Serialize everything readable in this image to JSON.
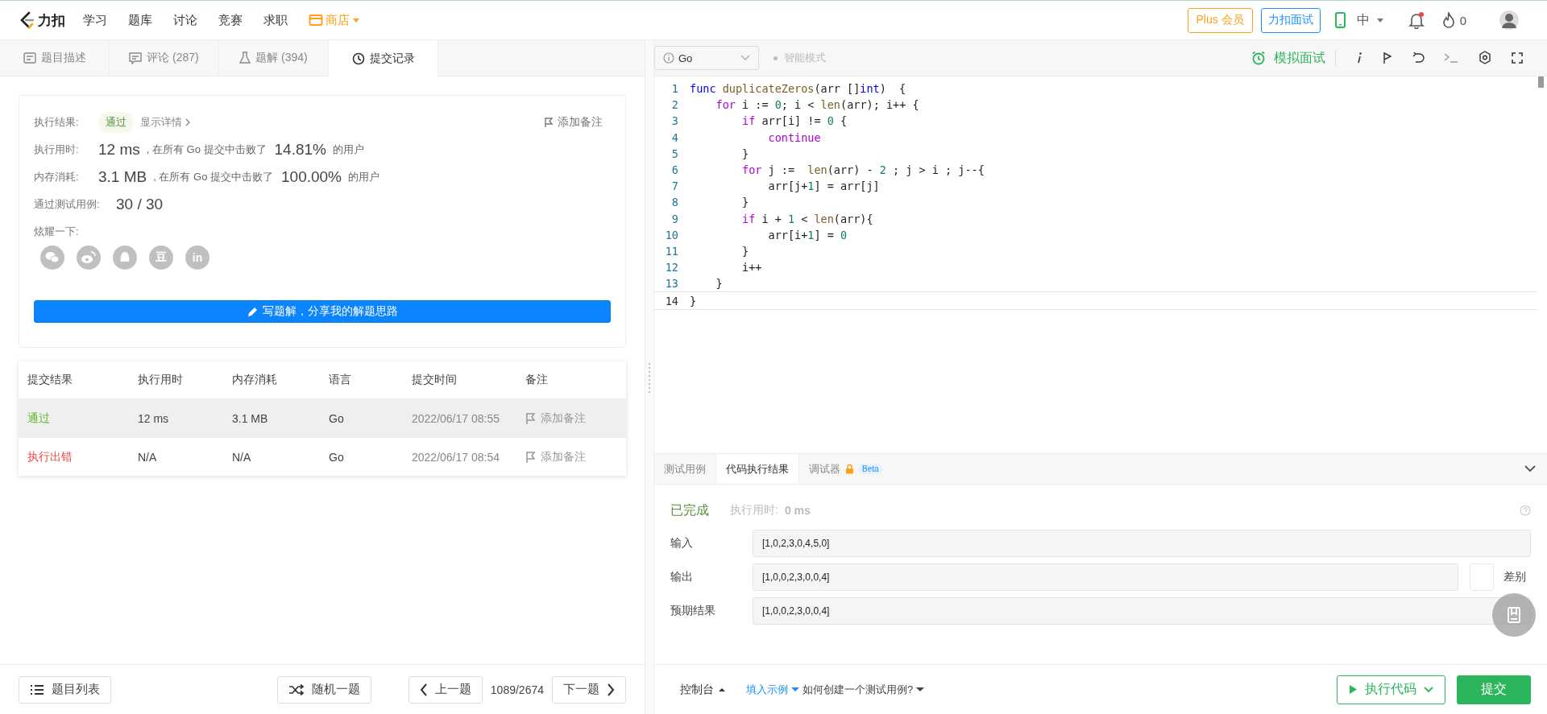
{
  "header": {
    "logo_text": "力扣",
    "nav": [
      {
        "label": "学习",
        "kind": "plain"
      },
      {
        "label": "题库",
        "kind": "plain"
      },
      {
        "label": "讨论",
        "kind": "plain"
      },
      {
        "label": "竞赛",
        "kind": "plain"
      },
      {
        "label": "求职",
        "kind": "plain"
      },
      {
        "label": "商店",
        "kind": "shop"
      }
    ],
    "plus_button": "Plus 会员",
    "interview_button": "力扣面试",
    "language": "中",
    "has_unread": true,
    "streak": "0"
  },
  "left_tabs": [
    {
      "label": "题目描述",
      "kind": "description",
      "selected": false
    },
    {
      "label": "评论 (287)",
      "kind": "comments",
      "selected": false
    },
    {
      "label": "题解 (394)",
      "kind": "solutions",
      "selected": false
    },
    {
      "label": "提交记录",
      "kind": "submissions",
      "selected": true
    }
  ],
  "result_card": {
    "result_label": "执行结果:",
    "status": "通过",
    "details_link": "显示详情",
    "add_note": "添加备注",
    "stats": [
      {
        "label": "执行用时:",
        "value": "12 ms",
        "middle": ", 在所有 Go 提交中击败了",
        "percent": "14.81%",
        "tail": "的用户"
      },
      {
        "label": "内存消耗:",
        "value": "3.1 MB",
        "middle": ", 在所有 Go 提交中击败了",
        "percent": "100.00%",
        "tail": "的用户"
      }
    ],
    "tests_label": "通过测试用例:",
    "tests_value": "30 / 30",
    "share_label": "炫耀一下:",
    "share": [
      {
        "kind": "wechat"
      },
      {
        "kind": "weibo"
      },
      {
        "kind": "qq"
      },
      {
        "kind": "douban",
        "glyph": "豆"
      },
      {
        "kind": "linkedin",
        "glyph": "in"
      }
    ],
    "write_button": "写题解，分享我的解题思路"
  },
  "submissions": {
    "columns": [
      "提交结果",
      "执行用时",
      "内存消耗",
      "语言",
      "提交时间",
      "备注"
    ],
    "rows": [
      {
        "result": "通过",
        "kind": "pass",
        "runtime": "12 ms",
        "memory": "3.1 MB",
        "language": "Go",
        "time": "2022/06/17 08:55",
        "note": "添加备注",
        "selected": true
      },
      {
        "result": "执行出错",
        "kind": "error",
        "runtime": "N/A",
        "memory": "N/A",
        "language": "Go",
        "time": "2022/06/17 08:54",
        "note": "添加备注",
        "selected": false
      }
    ]
  },
  "left_footer": {
    "list_button": "题目列表",
    "random_button": "随机一题",
    "prev_button": "上一题",
    "position": "1089/2674",
    "next_button": "下一题"
  },
  "editor_toolbar": {
    "language": "Go",
    "smart_mode": "智能模式",
    "smart_mode_on": false,
    "mock_interview": "模拟面试"
  },
  "code_lines": [
    {
      "number": "1",
      "tokens": [
        {
          "t": "func",
          "kind": "kw"
        },
        {
          "t": " duplicateZeros",
          "kind": "fn"
        },
        {
          "t": "(arr []",
          "kind": "plain"
        },
        {
          "t": "int",
          "kind": "kw"
        },
        {
          "t": ")  {",
          "kind": "plain"
        }
      ]
    },
    {
      "number": "2",
      "tokens": [
        {
          "t": "    for",
          "kind": "ctl"
        },
        {
          "t": " i := ",
          "kind": "plain"
        },
        {
          "t": "0",
          "kind": "num"
        },
        {
          "t": "; i < ",
          "kind": "plain"
        },
        {
          "t": "len",
          "kind": "fn"
        },
        {
          "t": "(arr); i++ {",
          "kind": "plain"
        }
      ]
    },
    {
      "number": "3",
      "tokens": [
        {
          "t": "        if",
          "kind": "ctl"
        },
        {
          "t": " arr[i] != ",
          "kind": "plain"
        },
        {
          "t": "0",
          "kind": "num"
        },
        {
          "t": " {",
          "kind": "plain"
        }
      ]
    },
    {
      "number": "4",
      "tokens": [
        {
          "t": "            continue",
          "kind": "ctl"
        }
      ]
    },
    {
      "number": "5",
      "tokens": [
        {
          "t": "        }",
          "kind": "plain"
        }
      ]
    },
    {
      "number": "6",
      "tokens": [
        {
          "t": "        for",
          "kind": "ctl"
        },
        {
          "t": " j :=  ",
          "kind": "plain"
        },
        {
          "t": "len",
          "kind": "fn"
        },
        {
          "t": "(arr) - ",
          "kind": "plain"
        },
        {
          "t": "2",
          "kind": "num"
        },
        {
          "t": " ; j > i ; j--{",
          "kind": "plain"
        }
      ]
    },
    {
      "number": "7",
      "tokens": [
        {
          "t": "            arr[j+",
          "kind": "plain"
        },
        {
          "t": "1",
          "kind": "num"
        },
        {
          "t": "] = arr[j]",
          "kind": "plain"
        }
      ]
    },
    {
      "number": "8",
      "tokens": [
        {
          "t": "        }",
          "kind": "plain"
        }
      ]
    },
    {
      "number": "9",
      "tokens": [
        {
          "t": "        if",
          "kind": "ctl"
        },
        {
          "t": " i + ",
          "kind": "plain"
        },
        {
          "t": "1",
          "kind": "num"
        },
        {
          "t": " < ",
          "kind": "plain"
        },
        {
          "t": "len",
          "kind": "fn"
        },
        {
          "t": "(arr){",
          "kind": "plain"
        }
      ]
    },
    {
      "number": "10",
      "tokens": [
        {
          "t": "            arr[i+",
          "kind": "plain"
        },
        {
          "t": "1",
          "kind": "num"
        },
        {
          "t": "] = ",
          "kind": "plain"
        },
        {
          "t": "0",
          "kind": "num"
        }
      ]
    },
    {
      "number": "11",
      "tokens": [
        {
          "t": "        }",
          "kind": "plain"
        }
      ]
    },
    {
      "number": "12",
      "tokens": [
        {
          "t": "        i++",
          "kind": "plain"
        }
      ]
    },
    {
      "number": "13",
      "tokens": [
        {
          "t": "    }",
          "kind": "plain"
        }
      ]
    },
    {
      "number": "14",
      "tokens": [
        {
          "t": "}",
          "kind": "plain"
        }
      ],
      "current": true
    }
  ],
  "console": {
    "tabs": [
      {
        "label": "测试用例",
        "selected": false
      },
      {
        "label": "代码执行结果",
        "selected": true
      },
      {
        "label": "调试器",
        "selected": false,
        "badge": "Beta"
      }
    ],
    "status": "已完成",
    "runtime_label": "执行用时:",
    "runtime_value": "0 ms",
    "fields": [
      {
        "label": "输入",
        "value": "[1,0,2,3,0,4,5,0]"
      },
      {
        "label": "输出",
        "value": "[1,0,0,2,3,0,0,4]",
        "diff_label": "差别",
        "diff_on": false
      },
      {
        "label": "预期结果",
        "value": "[1,0,0,2,3,0,0,4]"
      }
    ]
  },
  "right_footer": {
    "console_toggle": "控制台",
    "fill_example": "填入示例",
    "how_to": "如何创建一个测试用例?",
    "run_button": "执行代码",
    "submit_button": "提交"
  }
}
